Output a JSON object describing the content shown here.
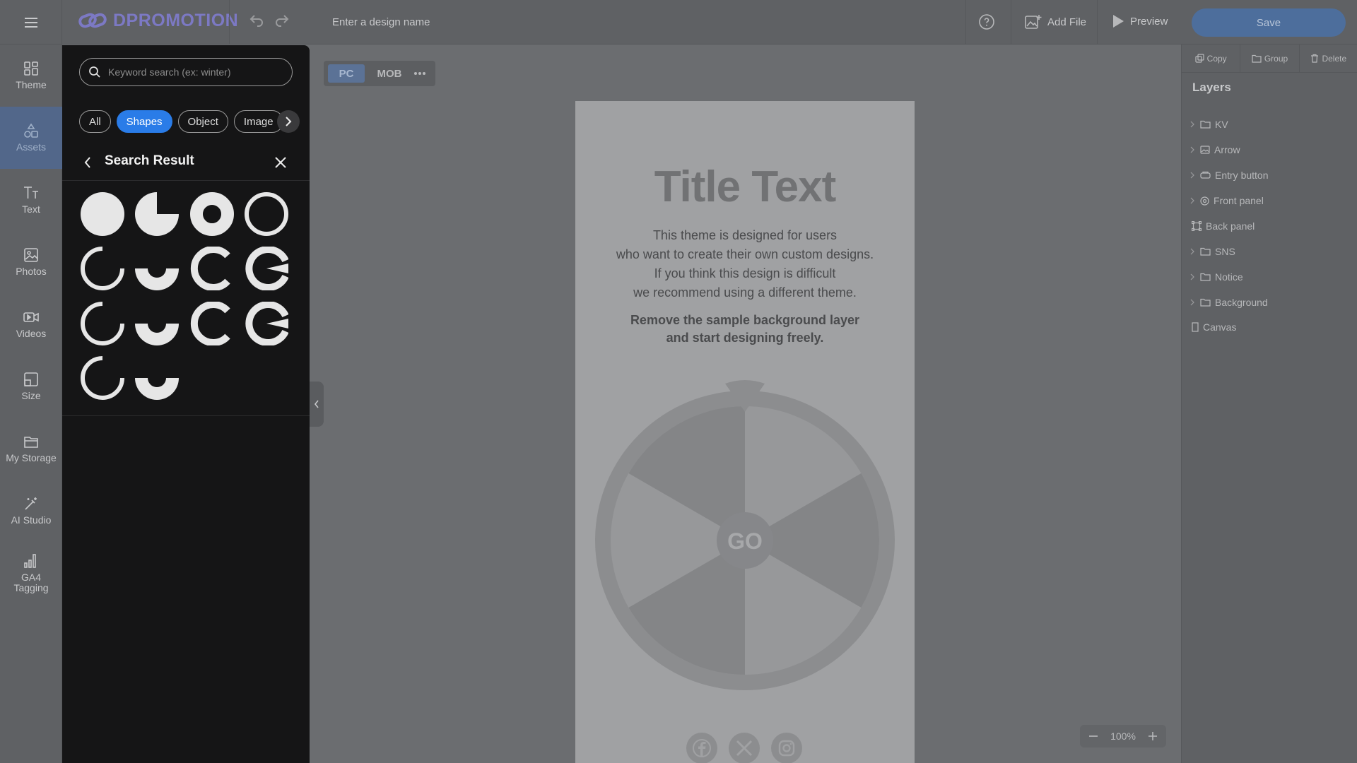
{
  "app": {
    "logo_text": "DPROMOTION",
    "design_name_placeholder": "Enter a design name",
    "add_file_label": "Add File",
    "preview_label": "Preview",
    "save_label": "Save"
  },
  "leftnav": {
    "items": [
      {
        "label": "Theme",
        "icon": "theme-icon"
      },
      {
        "label": "Assets",
        "icon": "assets-icon",
        "active": true
      },
      {
        "label": "Text",
        "icon": "text-icon"
      },
      {
        "label": "Photos",
        "icon": "photos-icon"
      },
      {
        "label": "Videos",
        "icon": "videos-icon"
      },
      {
        "label": "Size",
        "icon": "size-icon"
      },
      {
        "label": "My Storage",
        "icon": "folder-icon"
      },
      {
        "label": "AI Studio",
        "icon": "magic-wand-icon"
      },
      {
        "label": "GA4 Tagging",
        "icon": "bar-chart-icon"
      }
    ]
  },
  "assets": {
    "search_placeholder": "Keyword search (ex: winter)",
    "chips": [
      {
        "label": "All"
      },
      {
        "label": "Shapes",
        "active": true
      },
      {
        "label": "Object"
      },
      {
        "label": "Image"
      }
    ],
    "result_title": "Search Result",
    "shapes": [
      "filled-circle",
      "pie-three-quarter",
      "thick-ring",
      "thin-ring",
      "arc-open-right",
      "semicircle-ring-bottom",
      "c-ring-thick",
      "c-ring-wide",
      "arc-open-right",
      "semicircle-ring-bottom",
      "c-ring-thick",
      "c-ring-wide",
      "arc-open-right",
      "semicircle-ring-bottom"
    ]
  },
  "device": {
    "pc_label": "PC",
    "mob_label": "MOB",
    "active": "PC"
  },
  "canvas": {
    "title": "Title Text",
    "body_lines": [
      "This theme is designed for users",
      "who want to create their own custom designs.",
      "If you think this design is difficult",
      "we recommend using a different theme."
    ],
    "bold_lines": [
      "Remove the sample background layer",
      "and start designing freely."
    ],
    "wheel_center_label": "GO",
    "sns_icons": [
      "facebook-icon",
      "x-icon",
      "instagram-icon"
    ]
  },
  "zoom": {
    "value": "100%"
  },
  "rightpanel": {
    "actions": [
      {
        "label": "Copy",
        "icon": "copy-icon"
      },
      {
        "label": "Group",
        "icon": "folder-icon"
      },
      {
        "label": "Delete",
        "icon": "trash-icon"
      }
    ],
    "layers_title": "Layers",
    "layers": [
      {
        "label": "KV",
        "icon": "folder-icon",
        "expandable": true
      },
      {
        "label": "Arrow",
        "icon": "image-icon",
        "expandable": true
      },
      {
        "label": "Entry button",
        "icon": "button-icon",
        "expandable": true
      },
      {
        "label": "Front panel",
        "icon": "target-icon",
        "expandable": true
      },
      {
        "label": "Back panel",
        "icon": "frame-icon",
        "expandable": false
      },
      {
        "label": "SNS",
        "icon": "folder-icon",
        "expandable": true
      },
      {
        "label": "Notice",
        "icon": "folder-icon",
        "expandable": true
      },
      {
        "label": "Background",
        "icon": "folder-icon",
        "expandable": true
      },
      {
        "label": "Canvas",
        "icon": "rectangle-icon",
        "expandable": false
      }
    ]
  },
  "colors": {
    "accent": "#2a7ce8",
    "logo": "#7c79c4",
    "save_button": "#4d6e9c",
    "panel_bg": "#151516"
  }
}
